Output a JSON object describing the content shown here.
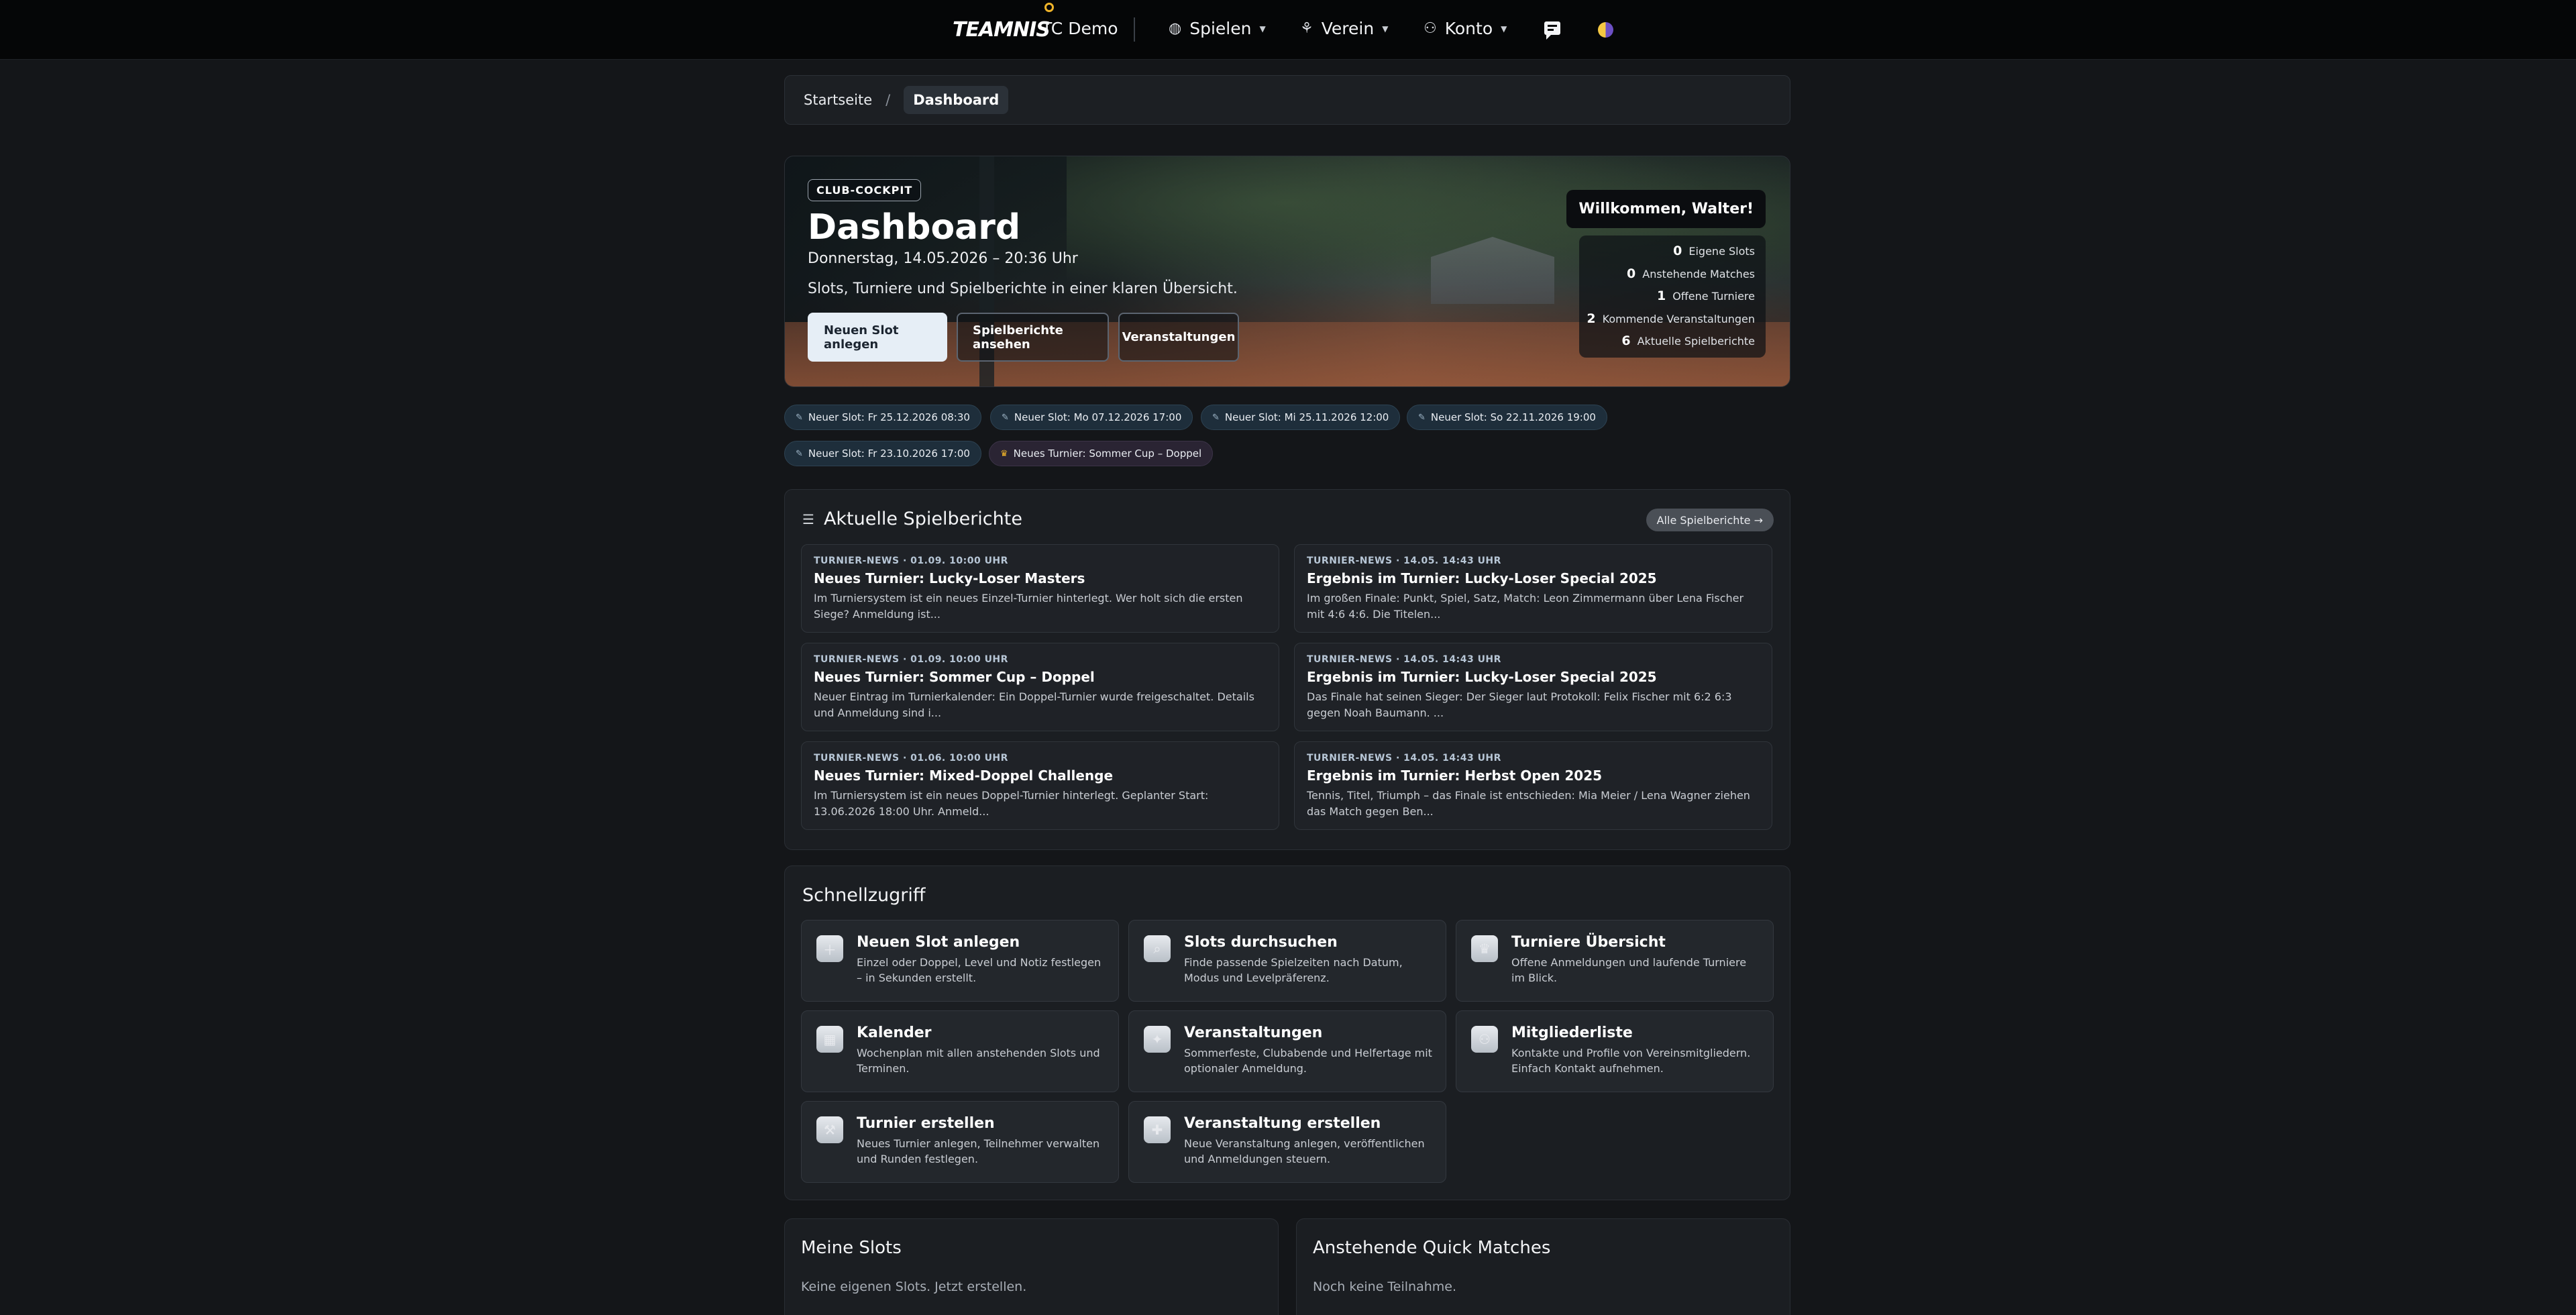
{
  "header": {
    "logo_text": "TEAMNIS",
    "club_name": "TC Demo",
    "nav": {
      "spielen": "Spielen",
      "verein": "Verein",
      "konto": "Konto"
    }
  },
  "breadcrumb": {
    "home": "Startseite",
    "separator": "/",
    "current": "Dashboard"
  },
  "hero": {
    "badge": "CLUB-COCKPIT",
    "title": "Dashboard",
    "date": "Donnerstag, 14.05.2026 – 20:36 Uhr",
    "subtitle": "Slots, Turniere und Spielberichte in einer klaren Übersicht.",
    "buttons": {
      "new_slot": "Neuen Slot anlegen",
      "reports": "Spielberichte ansehen",
      "events": "Veranstaltungen"
    },
    "welcome": "Willkommen, Walter!",
    "stats": [
      {
        "value": "0",
        "label": "Eigene Slots"
      },
      {
        "value": "0",
        "label": "Anstehende Matches"
      },
      {
        "value": "1",
        "label": "Offene Turniere"
      },
      {
        "value": "2",
        "label": "Kommende Veranstaltungen"
      },
      {
        "value": "6",
        "label": "Aktuelle Spielberichte"
      }
    ]
  },
  "chips": [
    {
      "icon": "racket-icon",
      "label": "Neuer Slot: Fr 25.12.2026 08:30"
    },
    {
      "icon": "racket-icon",
      "label": "Neuer Slot: Mo 07.12.2026 17:00"
    },
    {
      "icon": "racket-icon",
      "label": "Neuer Slot: Mi 25.11.2026 12:00"
    },
    {
      "icon": "racket-icon",
      "label": "Neuer Slot: So 22.11.2026 19:00"
    },
    {
      "icon": "racket-icon",
      "label": "Neuer Slot: Fr 23.10.2026 17:00"
    },
    {
      "icon": "trophy-icon",
      "label": "Neues Turnier: Sommer Cup – Doppel"
    }
  ],
  "reports": {
    "title": "Aktuelle Spielberichte",
    "all_link": "Alle Spielberichte →",
    "items": [
      {
        "meta": "TURNIER-NEWS · 01.09. 10:00 UHR",
        "title": "Neues Turnier: Lucky-Loser Masters",
        "text": "Im Turniersystem ist ein neues Einzel-Turnier hinterlegt. Wer holt sich die ersten Siege? Anmeldung ist..."
      },
      {
        "meta": "TURNIER-NEWS · 14.05. 14:43 UHR",
        "title": "Ergebnis im Turnier: Lucky-Loser Special 2025",
        "text": "Im großen Finale: Punkt, Spiel, Satz, Match: Leon Zimmermann über Lena Fischer mit 4:6 4:6. Die Titelen..."
      },
      {
        "meta": "TURNIER-NEWS · 01.09. 10:00 UHR",
        "title": "Neues Turnier: Sommer Cup – Doppel",
        "text": "Neuer Eintrag im Turnierkalender: Ein Doppel-Turnier wurde freigeschaltet. Details und Anmeldung sind i..."
      },
      {
        "meta": "TURNIER-NEWS · 14.05. 14:43 UHR",
        "title": "Ergebnis im Turnier: Lucky-Loser Special 2025",
        "text": "Das Finale hat seinen Sieger: Der Sieger laut Protokoll: Felix Fischer mit 6:2 6:3 gegen Noah Baumann. ..."
      },
      {
        "meta": "TURNIER-NEWS · 01.06. 10:00 UHR",
        "title": "Neues Turnier: Mixed-Doppel Challenge",
        "text": "Im Turniersystem ist ein neues Doppel-Turnier hinterlegt. Geplanter Start: 13.06.2026 18:00 Uhr. Anmeld..."
      },
      {
        "meta": "TURNIER-NEWS · 14.05. 14:43 UHR",
        "title": "Ergebnis im Turnier: Herbst Open 2025",
        "text": "Tennis, Titel, Triumph – das Finale ist entschieden: Mia Meier / Lena Wagner ziehen das Match gegen Ben..."
      }
    ]
  },
  "quick": {
    "title": "Schnellzugriff",
    "tiles": [
      {
        "icon": "plus-icon",
        "title": "Neuen Slot anlegen",
        "desc": "Einzel oder Doppel, Level und Notiz festlegen – in Sekunden erstellt."
      },
      {
        "icon": "search-icon",
        "title": "Slots durchsuchen",
        "desc": "Finde passende Spielzeiten nach Datum, Modus und Levelpräferenz."
      },
      {
        "icon": "trophy-icon",
        "title": "Turniere Übersicht",
        "desc": "Offene Anmeldungen und laufende Turniere im Blick."
      },
      {
        "icon": "calendar-icon",
        "title": "Kalender",
        "desc": "Wochenplan mit allen anstehenden Slots und Terminen."
      },
      {
        "icon": "party-icon",
        "title": "Veranstaltungen",
        "desc": "Sommerfeste, Clubabende und Helfertage mit optionaler Anmeldung."
      },
      {
        "icon": "members-icon",
        "title": "Mitgliederliste",
        "desc": "Kontakte und Profile von Vereinsmitgliedern. Einfach Kontakt aufnehmen."
      },
      {
        "icon": "tools-icon",
        "title": "Turnier erstellen",
        "desc": "Neues Turnier anlegen, Teilnehmer verwalten und Runden festlegen."
      },
      {
        "icon": "event-add-icon",
        "title": "Veranstaltung erstellen",
        "desc": "Neue Veranstaltung anlegen, veröffentlichen und Anmeldungen steuern."
      }
    ]
  },
  "my_slots": {
    "title": "Meine Slots",
    "text": "Keine eigenen Slots. Jetzt erstellen."
  },
  "quick_matches": {
    "title": "Anstehende Quick Matches",
    "text": "Noch keine Teilnahme."
  }
}
